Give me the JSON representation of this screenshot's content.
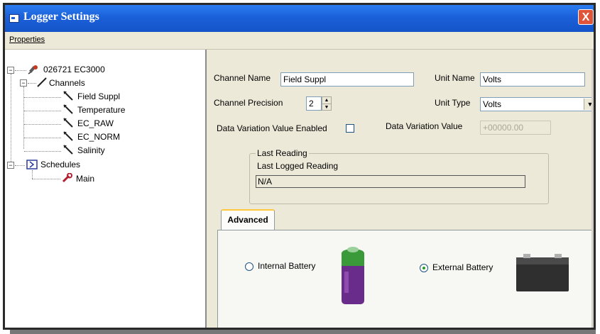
{
  "window": {
    "title": "Logger Settings",
    "close_label": "X"
  },
  "menu": {
    "properties": "Properties"
  },
  "tree": {
    "root": "026721 EC3000",
    "channels": "Channels",
    "channel_items": [
      "Field Suppl",
      "Temperature",
      "EC_RAW",
      "EC_NORM",
      "Salinity"
    ],
    "schedules": "Schedules",
    "schedule_items": [
      "Main"
    ],
    "expand_symbol": "−"
  },
  "form": {
    "channel_name_label": "Channel Name",
    "channel_name_value": "Field Suppl",
    "unit_name_label": "Unit Name",
    "unit_name_value": "Volts",
    "precision_label": "Channel Precision",
    "precision_value": "2",
    "unit_type_label": "Unit Type",
    "unit_type_value": "Volts",
    "dv_enabled_label": "Data Variation Value Enabled",
    "dv_enabled_checked": false,
    "dv_value_label": "Data Variation Value",
    "dv_value": "+00000.00"
  },
  "last_reading": {
    "group_title": "Last Reading",
    "logged_label": "Last Logged Reading",
    "value": "N/A"
  },
  "tabs": {
    "advanced": "Advanced"
  },
  "battery": {
    "internal_label": "Internal Battery",
    "internal_selected": false,
    "external_label": "External Battery",
    "external_selected": true
  },
  "colors": {
    "titlebar": "#1b60d9",
    "close_button": "#e0553a",
    "tab_highlight": "#ffc83c",
    "radio_dot": "#21a121",
    "battery_purple": "#6a2c8a",
    "battery_green": "#3a9a3a"
  },
  "icons": {
    "title": "window-icon",
    "root": "logger-device-icon",
    "channels": "channels-icon",
    "channel": "probe-icon",
    "schedules": "schedule-icon",
    "schedule": "wrench-icon",
    "spin_up": "▲",
    "spin_down": "▼",
    "dropdown": "▼"
  }
}
